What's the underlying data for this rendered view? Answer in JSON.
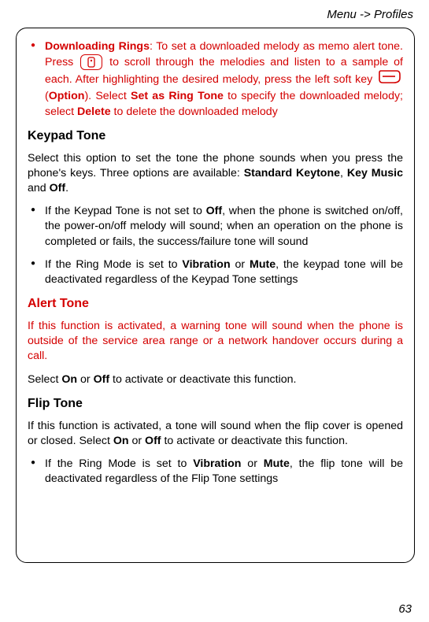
{
  "breadcrumb": "Menu -> Profiles",
  "bullet_dl": {
    "title": "Downloading Rings",
    "t1": ": To set a downloaded melody as memo alert tone. Press ",
    "t2": " to scroll through the melodies and listen to a sample of each. After highlighting the desired melody, press the left soft key ",
    "t3": " (",
    "option": "Option",
    "t4": "). Select ",
    "set_as": "Set as Ring Tone",
    "t5": " to specify the downloaded melody; select ",
    "delete": "Delete",
    "t6": " to delete the downloaded melody"
  },
  "keypad": {
    "head": "Keypad Tone",
    "p1a": "Select this option to set the tone the phone sounds when you press the phone's keys. Three options are available: ",
    "b1": "Standard Keytone",
    "sep1": ", ",
    "b2": "Key Music",
    "sep2": " and ",
    "b3": "Off",
    "p1b": ".",
    "li1a": "If the Keypad Tone is not set to ",
    "li1_off": "Off",
    "li1b": ", when the phone is switched on/off, the power-on/off melody will sound; when an operation on the phone is completed or fails, the success/failure tone will sound",
    "li2a": "If the Ring Mode is set to ",
    "li2_vib": "Vibration",
    "li2_or": " or ",
    "li2_mute": "Mute",
    "li2b": ", the keypad tone will be deactivated regardless of the Keypad Tone settings"
  },
  "alert": {
    "head": "Alert Tone",
    "p1": "If this function is activated, a warning tone will sound when the phone is outside of the service area range or a network handover occurs during a call.",
    "p2a": "Select ",
    "on": "On",
    "or": " or ",
    "off": "Off",
    "p2b": " to activate or deactivate this function."
  },
  "flip": {
    "head": "Flip Tone",
    "p1a": "If this function is activated, a tone will sound when the flip cover is opened or closed. Select ",
    "on": "On",
    "or": " or ",
    "off": "Off",
    "p1b": " to activate or deactivate this function.",
    "li1a": "If the Ring Mode is set to ",
    "vib": "Vibration",
    "lor": " or ",
    "mute": "Mute",
    "li1b": ", the flip tone will be deactivated regardless of the Flip Tone settings"
  },
  "page_number": "63"
}
